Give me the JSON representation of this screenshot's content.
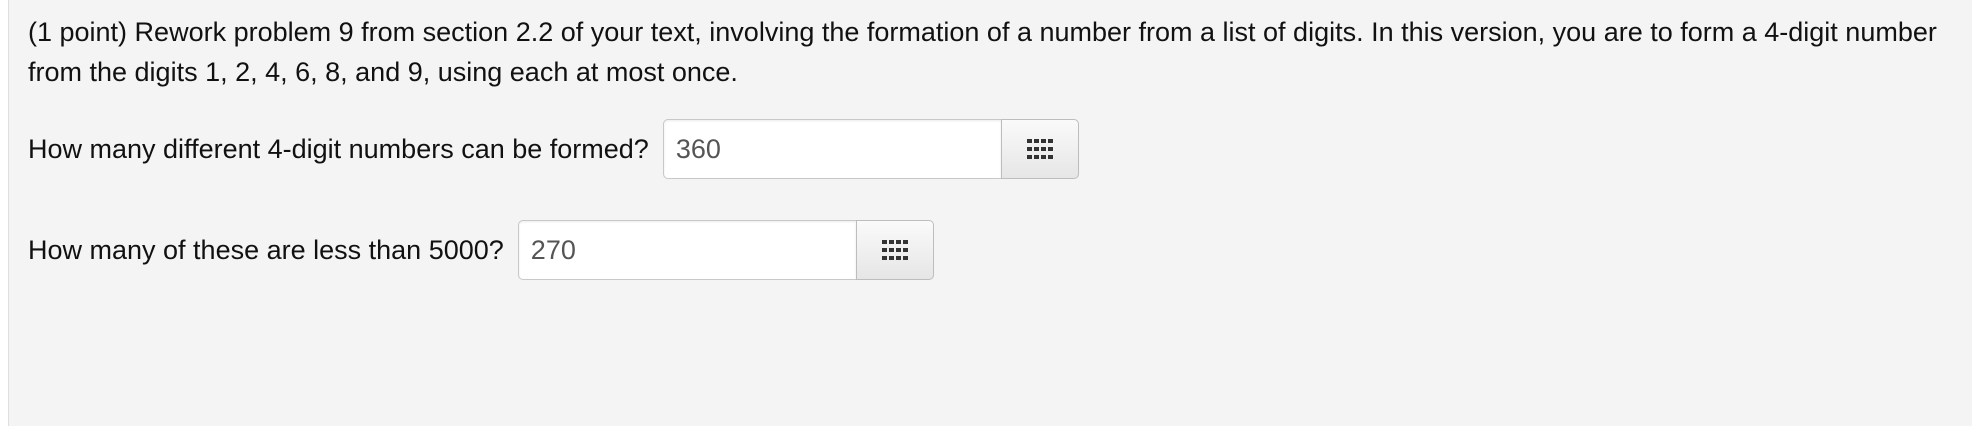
{
  "problem": {
    "text": "(1 point) Rework problem 9 from section 2.2 of your text, involving the formation of a number from a list of digits. In this version, you are to form a 4-digit number from the digits 1, 2, 4, 6, 8, and 9, using each at most once."
  },
  "questions": [
    {
      "label": "How many different 4-digit numbers can be formed?",
      "answer": "360",
      "button_icon": "grid-keypad-icon"
    },
    {
      "label": "How many of these are less than 5000?",
      "answer": "270",
      "button_icon": "grid-keypad-icon"
    }
  ],
  "colors": {
    "panel_background": "#f4f4f4",
    "input_background": "#ffffff",
    "icon_color": "#333333"
  }
}
